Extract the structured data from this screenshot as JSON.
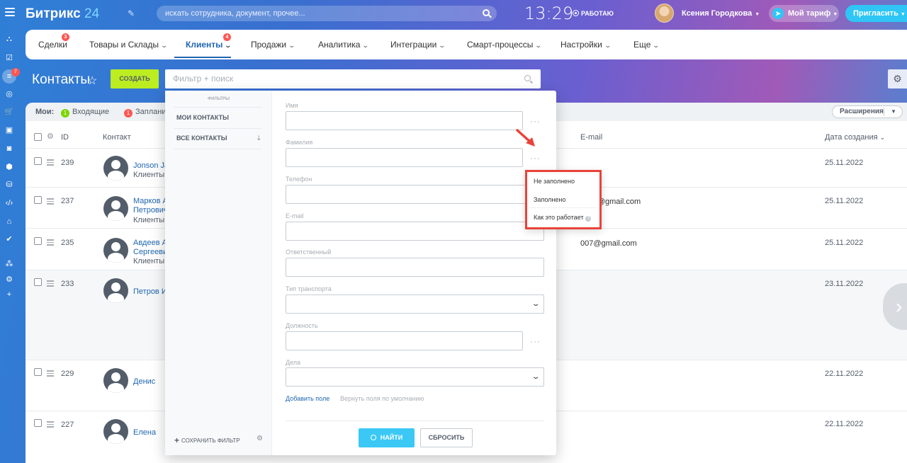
{
  "header": {
    "logo_text": "Битрикс",
    "logo_num": "24",
    "search_placeholder": "искать сотрудника, документ, прочее...",
    "clock": "13:29",
    "work_status": "РАБОТАЮ",
    "user_name": "Ксения Городкова",
    "tariff_label": "Мой тариф",
    "invite_label": "Пригласить"
  },
  "rail": {
    "badge": "7"
  },
  "nav": {
    "items": [
      {
        "label": "Сделки",
        "badge": "3"
      },
      {
        "label": "Товары и Склады"
      },
      {
        "label": "Клиенты",
        "badge": "4"
      },
      {
        "label": "Продажи"
      },
      {
        "label": "Аналитика"
      },
      {
        "label": "Интеграции"
      },
      {
        "label": "Смарт-процессы"
      },
      {
        "label": "Настройки"
      },
      {
        "label": "Еще"
      }
    ]
  },
  "page": {
    "title": "Контакты",
    "create_label": "СОЗДАТЬ",
    "filter_placeholder": "Фильтр + поиск"
  },
  "counters": {
    "label": "Мои:",
    "incoming_count": "1",
    "incoming_label": "Входящие",
    "planned_count": "1",
    "planned_label": "Запланир",
    "extensions_label": "Расширения"
  },
  "table": {
    "headers": {
      "id": "ID",
      "contact": "Контакт",
      "email": "E-mail",
      "created": "Дата создания"
    },
    "rows": [
      {
        "id": "239",
        "name": "Jonson Jac",
        "name2": "",
        "type": "Клиенты",
        "email": "",
        "date": "25.11.2022"
      },
      {
        "id": "237",
        "name": "Марков А",
        "name2": "Петрович",
        "type": "Клиенты",
        "email": "pany@gmail.com",
        "date": "25.11.2022"
      },
      {
        "id": "235",
        "name": "Авдеев А",
        "name2": "Сергеевич",
        "type": "Клиенты",
        "email": "007@gmail.com",
        "date": "25.11.2022"
      },
      {
        "id": "233",
        "name": "Петров И.",
        "name2": "",
        "type": "",
        "email": "",
        "date": "23.11.2022"
      },
      {
        "id": "229",
        "name": "Денис",
        "name2": "",
        "type": "",
        "email": "",
        "date": "22.11.2022"
      },
      {
        "id": "227",
        "name": "Елена",
        "name2": "",
        "type": "",
        "email": "",
        "date": "22.11.2022"
      }
    ]
  },
  "filter_popup": {
    "header": "ФИЛЬТРЫ",
    "presets": [
      "МОИ КОНТАКТЫ",
      "ВСЕ КОНТАКТЫ"
    ],
    "save_filter": "СОХРАНИТЬ ФИЛЬТР",
    "fields": {
      "name": "Имя",
      "surname": "Фамилия",
      "phone": "Телефон",
      "email": "E-mail",
      "responsible": "Ответственный",
      "transport": "Тип транспорта",
      "position": "Должность",
      "tasks": "Дела"
    },
    "add_field": "Добавить поле",
    "reset_fields": "Вернуть поля по умолчанию",
    "find_label": "НАЙТИ",
    "reset_label": "СБРОСИТЬ"
  },
  "context_menu": {
    "items": [
      "Не заполнено",
      "Заполнено",
      "Как это работает"
    ]
  },
  "colors": {
    "accent_green": "#bbed21",
    "accent_blue": "#3bc8f5",
    "highlight_red": "#e9433a",
    "link": "#2067b0"
  }
}
